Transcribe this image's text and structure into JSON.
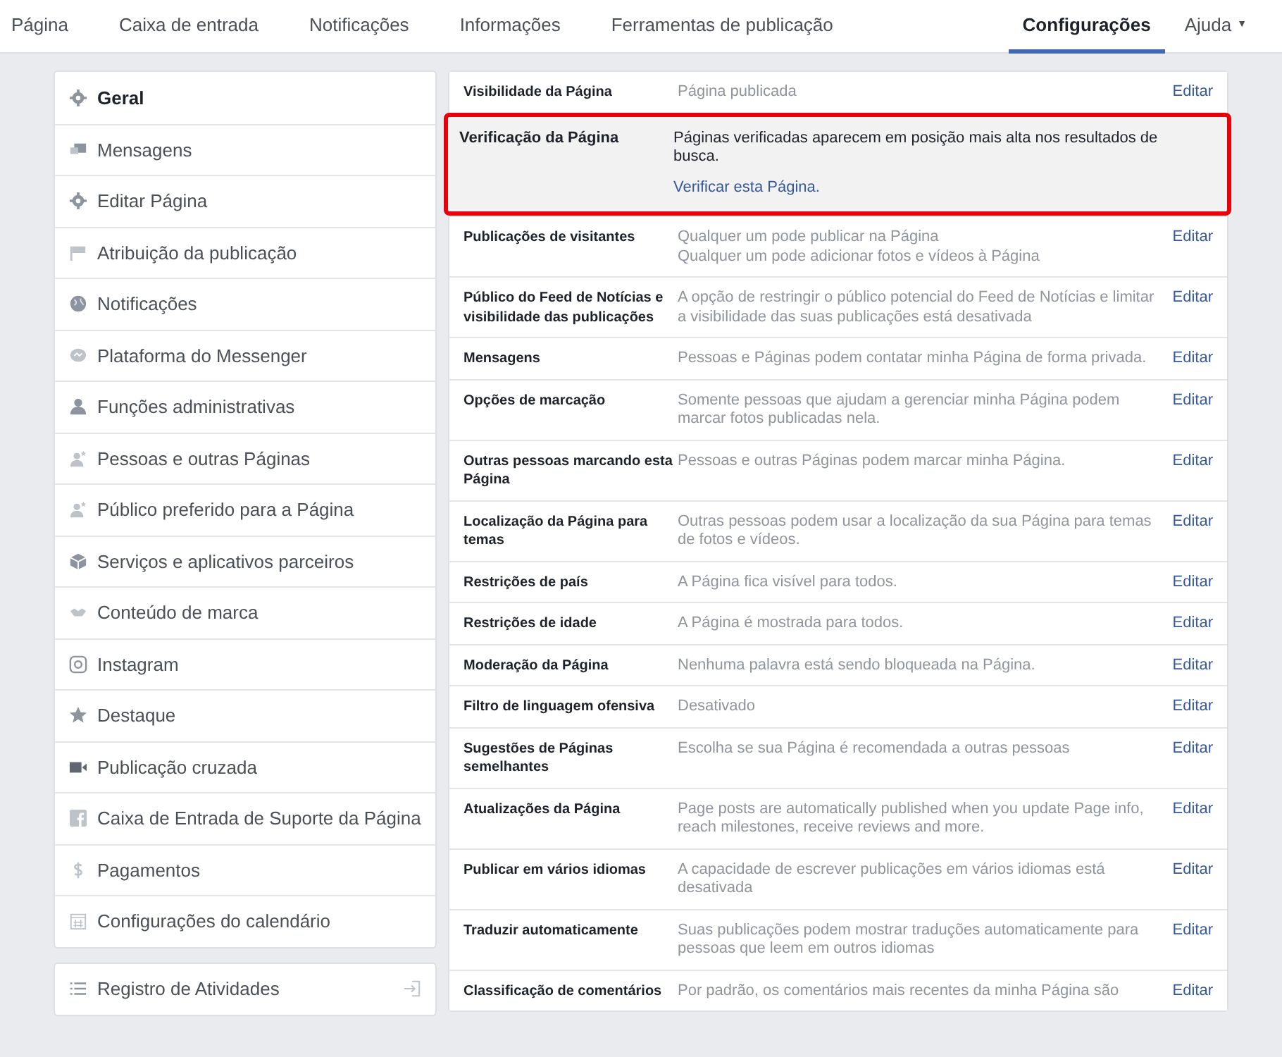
{
  "top_nav": {
    "tabs": [
      {
        "label": "Página",
        "selected": false
      },
      {
        "label": "Caixa de entrada",
        "selected": false
      },
      {
        "label": "Notificações",
        "selected": false
      },
      {
        "label": "Informações",
        "selected": false
      },
      {
        "label": "Ferramentas de publicação",
        "selected": false
      },
      {
        "label": "Configurações",
        "selected": true
      }
    ],
    "help": {
      "label": "Ajuda",
      "caret": "▼"
    }
  },
  "sidebar": {
    "items": [
      {
        "label": "Geral",
        "selected": true
      },
      {
        "label": "Mensagens",
        "selected": false
      },
      {
        "label": "Editar Página",
        "selected": false
      },
      {
        "label": "Atribuição da publicação",
        "selected": false
      },
      {
        "label": "Notificações",
        "selected": false
      },
      {
        "label": "Plataforma do Messenger",
        "selected": false
      },
      {
        "label": "Funções administrativas",
        "selected": false
      },
      {
        "label": "Pessoas e outras Páginas",
        "selected": false
      },
      {
        "label": "Público preferido para a Página",
        "selected": false
      },
      {
        "label": "Serviços e aplicativos parceiros",
        "selected": false
      },
      {
        "label": "Conteúdo de marca",
        "selected": false
      },
      {
        "label": "Instagram",
        "selected": false
      },
      {
        "label": "Destaque",
        "selected": false
      },
      {
        "label": "Publicação cruzada",
        "selected": false
      },
      {
        "label": "Caixa de Entrada de Suporte da Página",
        "selected": false
      },
      {
        "label": "Pagamentos",
        "selected": false
      },
      {
        "label": "Configurações do calendário",
        "selected": false
      }
    ],
    "activity_log": {
      "label": "Registro de Atividades"
    }
  },
  "settings": {
    "rows": [
      {
        "label": "Visibilidade da Página",
        "lines": [
          "Página publicada"
        ],
        "edit": "Editar",
        "highlighted": false
      },
      {
        "label": "Verificação da Página",
        "lines": [
          "Páginas verificadas aparecem em posição mais alta nos resultados de busca."
        ],
        "link": "Verificar esta Página.",
        "highlighted": true
      },
      {
        "label": "Publicações de visitantes",
        "lines": [
          "Qualquer um pode publicar na Página",
          "Qualquer um pode adicionar fotos e vídeos à Página"
        ],
        "edit": "Editar",
        "highlighted": false
      },
      {
        "label": "Público do Feed de Notícias e visibilidade das publicações",
        "lines": [
          "A opção de restringir o público potencial do Feed de Notícias e limitar a visibilidade das suas publicações está desativada"
        ],
        "edit": "Editar",
        "highlighted": false
      },
      {
        "label": "Mensagens",
        "lines": [
          "Pessoas e Páginas podem contatar minha Página de forma privada."
        ],
        "edit": "Editar",
        "highlighted": false
      },
      {
        "label": "Opções de marcação",
        "lines": [
          "Somente pessoas que ajudam a gerenciar minha Página podem marcar fotos publicadas nela."
        ],
        "edit": "Editar",
        "highlighted": false
      },
      {
        "label": "Outras pessoas marcando esta Página",
        "lines": [
          "Pessoas e outras Páginas podem marcar minha Página."
        ],
        "edit": "Editar",
        "highlighted": false
      },
      {
        "label": "Localização da Página para temas",
        "lines": [
          "Outras pessoas podem usar a localização da sua Página para temas de fotos e vídeos."
        ],
        "edit": "Editar",
        "highlighted": false
      },
      {
        "label": "Restrições de país",
        "lines": [
          "A Página fica visível para todos."
        ],
        "edit": "Editar",
        "highlighted": false
      },
      {
        "label": "Restrições de idade",
        "lines": [
          "A Página é mostrada para todos."
        ],
        "edit": "Editar",
        "highlighted": false
      },
      {
        "label": "Moderação da Página",
        "lines": [
          "Nenhuma palavra está sendo bloqueada na Página."
        ],
        "edit": "Editar",
        "highlighted": false
      },
      {
        "label": "Filtro de linguagem ofensiva",
        "lines": [
          "Desativado"
        ],
        "edit": "Editar",
        "highlighted": false
      },
      {
        "label": "Sugestões de Páginas semelhantes",
        "lines": [
          "Escolha se sua Página é recomendada a outras pessoas"
        ],
        "edit": "Editar",
        "highlighted": false
      },
      {
        "label": "Atualizações da Página",
        "lines": [
          "Page posts are automatically published when you update Page info, reach milestones, receive reviews and more."
        ],
        "edit": "Editar",
        "highlighted": false
      },
      {
        "label": "Publicar em vários idiomas",
        "lines": [
          "A capacidade de escrever publicações em vários idiomas está desativada"
        ],
        "edit": "Editar",
        "highlighted": false
      },
      {
        "label": "Traduzir automaticamente",
        "lines": [
          "Suas publicações podem mostrar traduções automaticamente para pessoas que leem em outros idiomas"
        ],
        "edit": "Editar",
        "highlighted": false
      },
      {
        "label": "Classificação de comentários",
        "lines": [
          "Por padrão, os comentários mais recentes da minha Página são"
        ],
        "edit": "Editar",
        "highlighted": false
      }
    ]
  }
}
